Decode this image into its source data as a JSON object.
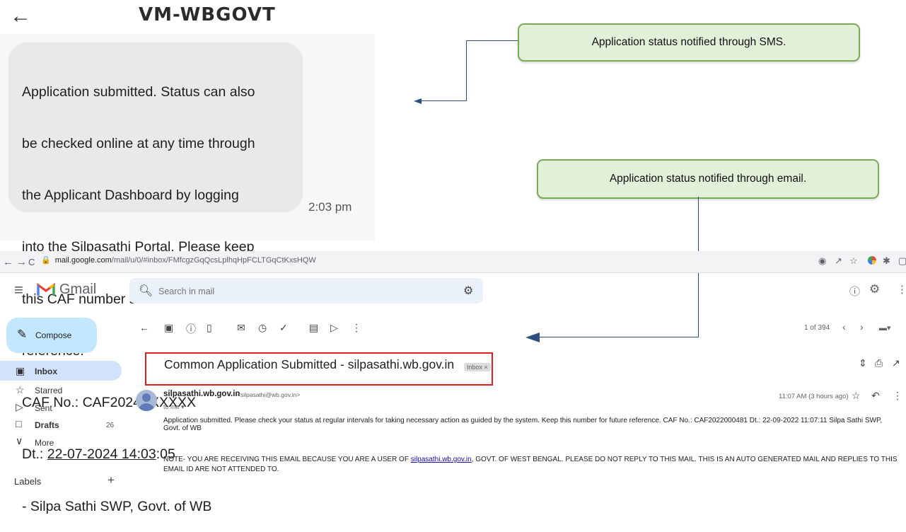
{
  "sms": {
    "back_icon": "arrow-left-icon",
    "sender": "VM-WBGOVT",
    "lines": [
      "Application submitted. Status can also",
      "be checked online at any time through",
      "the Applicant Dashboard by logging",
      "into the Silpasathi Portal. Please keep",
      "this CAF number saved for future",
      "reference.",
      "CAF No.: CAF2024XXXXXX"
    ],
    "date_prefix": "Dt.: ",
    "date_underlined": "22-07-2024 14:03",
    "date_suffix": ":05",
    "signature": "- Silpa Sathi SWP, Govt. of WB",
    "time": "2:03 pm"
  },
  "callouts": {
    "sms": "Application status notified through SMS.",
    "email": "Application status notified through email."
  },
  "browser": {
    "back": "←",
    "forward": "→",
    "reload": "C",
    "url_host": "mail.google.com",
    "url_path": "/mail/u/0/#inbox/FMfcgzGqQcsLplhqHpFCLTGqCtKxsHQW"
  },
  "gmail": {
    "brand": "Gmail",
    "search_placeholder": "Search in mail",
    "compose": "Compose",
    "nav": [
      {
        "label": "Inbox",
        "count": ""
      },
      {
        "label": "Starred",
        "count": ""
      },
      {
        "label": "Sent",
        "count": ""
      },
      {
        "label": "Drafts",
        "count": "26"
      },
      {
        "label": "More",
        "count": ""
      }
    ],
    "labels_title": "Labels",
    "labels_add": "+",
    "pager": "1 of 394",
    "subject": "Common Application Submitted - silpasathi.wb.gov.in",
    "subject_chip": "Inbox ×",
    "from_name": "silpasathi.wb.gov.in",
    "from_addr": "<silpasathi@wb.gov.in>",
    "to": "to me ▾",
    "time": "11:07 AM (3 hours ago)",
    "body": "Application submitted. Please check your status at regular intervals for taking necessary action as guided by the system. Keep this number for future reference. CAF No.: CAF2022000481 Dt.: 22-09-2022 11:07:11 Silpa Sathi SWP, Govt. of WB",
    "note_prefix": "NOTE- YOU ARE RECEIVING THIS EMAIL BECAUSE YOU ARE A USER OF ",
    "note_link": "silpasathi.wb.gov.in",
    "note_suffix": ", GOVT. OF WEST BENGAL. PLEASE DO NOT REPLY TO THIS MAIL. THIS IS AN AUTO GENERATED MAIL AND REPLIES TO THIS EMAIL ID ARE NOT ATTENDED TO."
  },
  "colors": {
    "callout_fill": "#e2efd9",
    "callout_border": "#7aaa55",
    "highlight_box": "#e02020",
    "connector": "#2f4f80"
  }
}
